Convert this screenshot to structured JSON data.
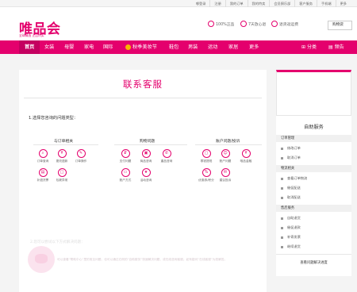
{
  "topbar": {
    "links": [
      "哪登录",
      "注册",
      "我的订单",
      "我的特卖",
      "会员俱乐部",
      "客户服务",
      "手机端",
      "更多"
    ]
  },
  "header": {
    "logo": "唯品会",
    "logo_sub": "全球精选 正品特卖",
    "promises": [
      "100%正品",
      "7天放心退",
      "退货返运费"
    ],
    "cart_label": "购物袋"
  },
  "nav": {
    "home": "首页",
    "items": [
      "女装",
      "母婴",
      "家电",
      "国际",
      "秋季美妆节",
      "鞋包",
      "男装",
      "运动",
      "家居",
      "更多"
    ],
    "right": [
      "分类",
      "频告"
    ]
  },
  "main": {
    "title": "联系客服",
    "question": "1.选择您咨询的问题类型：",
    "categories": [
      {
        "name": "与订单相关",
        "items": [
          "订单查询",
          "更改退款",
          "订单操作",
          "补退货票",
          "包裹异常"
        ]
      },
      {
        "name": "购物问题",
        "items": [
          "支付问题",
          "商品咨询",
          "重品咨询",
          "账户方式",
          "活动咨询"
        ]
      },
      {
        "name": "账户问题/投诉",
        "items": [
          "零钱提现",
          "账户问题",
          "唯品金融",
          "优惠券/积分",
          "建议投诉"
        ]
      }
    ],
    "faded_text": "2.您可以尝试以下方式解决问题：",
    "note": "可以查看“帮助中心”里的常见问题、也可以通过右侧的“自助服务”快速解决问题，或在线咨询客服。如有疑问“在线客服”为您解答。"
  },
  "sidebar": {
    "title": "自助服务",
    "sections": [
      {
        "name": "订单管理",
        "items": [
          "修改订单",
          "取消订单"
        ]
      },
      {
        "name": "物流相关",
        "items": [
          "查看订单物流",
          "催促配送",
          "取消配送"
        ]
      },
      {
        "name": "售后服务",
        "items": [
          "自助退货",
          "催促退款",
          "补寄发票",
          "继续退货"
        ]
      }
    ],
    "footer": "查看问题解决进度"
  },
  "colors": {
    "accent": "#e4006d"
  }
}
